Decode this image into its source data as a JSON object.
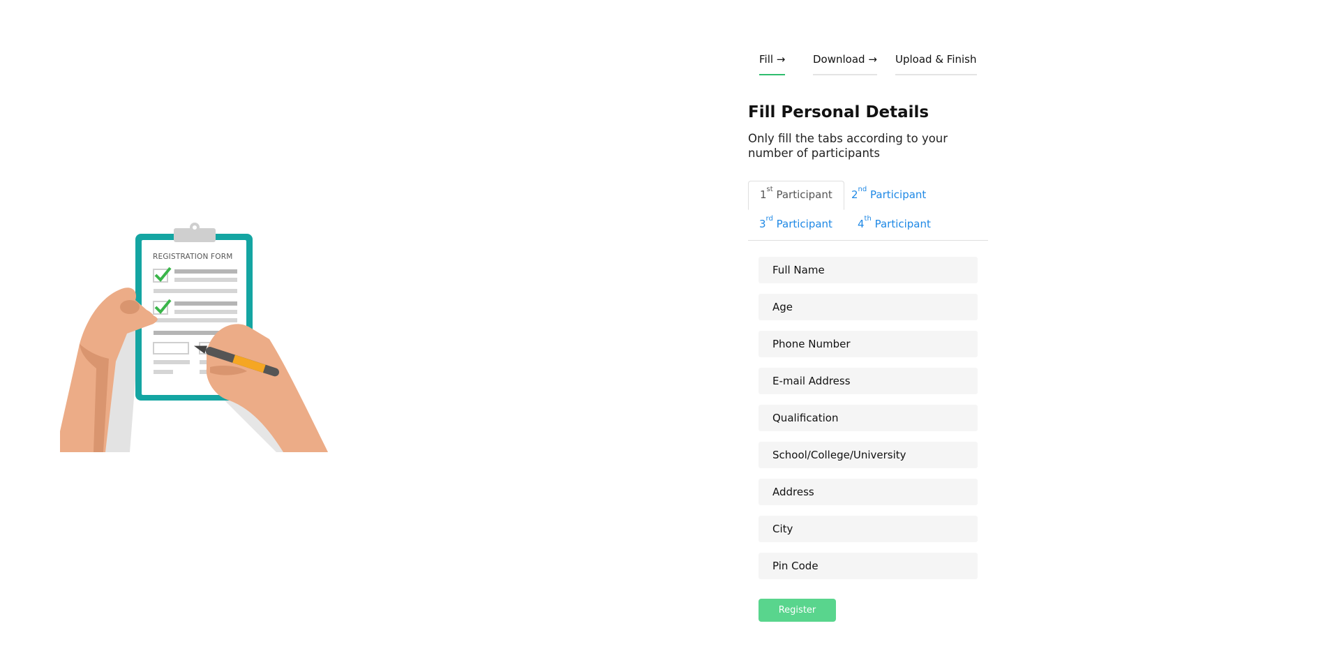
{
  "illustration": {
    "form_title": "REGISTRATION FORM",
    "colors": {
      "board": "#14a5a2",
      "skin": "#ecac87",
      "check": "#3ab54a",
      "pen": "#f5a623"
    }
  },
  "steps": [
    {
      "label": "Fill →",
      "active": true
    },
    {
      "label": "Download →",
      "active": false
    },
    {
      "label": "Upload & Finish",
      "active": false
    }
  ],
  "heading": {
    "title": "Fill Personal Details",
    "subtitle": "Only fill the tabs according to your number of participants"
  },
  "participant_tabs": [
    {
      "num": "1",
      "sup": "st",
      "label": "Participant",
      "active": true
    },
    {
      "num": "2",
      "sup": "nd",
      "label": "Participant",
      "active": false
    },
    {
      "num": "3",
      "sup": "rd",
      "label": "Participant",
      "active": false
    },
    {
      "num": "4",
      "sup": "th",
      "label": "Participant",
      "active": false
    }
  ],
  "form": {
    "fields": [
      {
        "placeholder": "Full Name",
        "value": ""
      },
      {
        "placeholder": "Age",
        "value": ""
      },
      {
        "placeholder": "Phone Number",
        "value": ""
      },
      {
        "placeholder": "E-mail Address",
        "value": ""
      },
      {
        "placeholder": "Qualification",
        "value": ""
      },
      {
        "placeholder": "School/College/University",
        "value": ""
      },
      {
        "placeholder": "Address",
        "value": ""
      },
      {
        "placeholder": "City",
        "value": ""
      },
      {
        "placeholder": "Pin Code",
        "value": ""
      }
    ],
    "submit_label": "Register"
  },
  "colors": {
    "accent_green": "#59d58d",
    "step_underline_active": "#2ebd6e",
    "link_blue": "#1e88e5",
    "field_bg": "#f5f5f5"
  }
}
